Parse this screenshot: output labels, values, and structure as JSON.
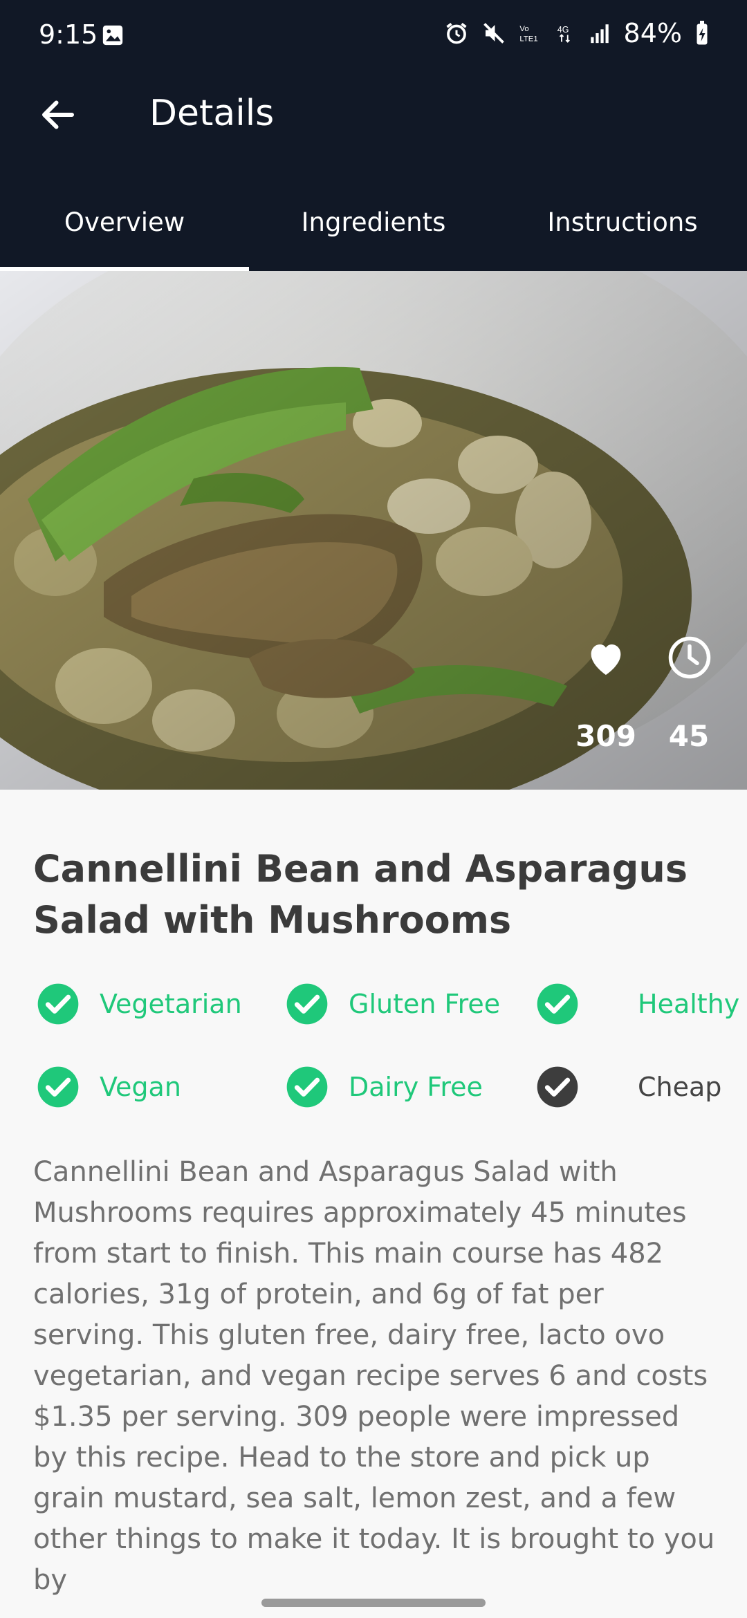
{
  "status_bar": {
    "time": "9:15",
    "battery": "84%"
  },
  "appbar": {
    "title": "Details"
  },
  "tabs": [
    {
      "label": "Overview",
      "active": true
    },
    {
      "label": "Ingredients",
      "active": false
    },
    {
      "label": "Instructions",
      "active": false
    }
  ],
  "hero": {
    "likes": "309",
    "minutes": "45"
  },
  "recipe": {
    "title": "Cannellini Bean and Asparagus Salad with Mushrooms",
    "badges": [
      {
        "label": "Vegetarian",
        "active": true
      },
      {
        "label": "Gluten Free",
        "active": true
      },
      {
        "label": "Healthy",
        "active": true
      },
      {
        "label": "Vegan",
        "active": true
      },
      {
        "label": "Dairy Free",
        "active": true
      },
      {
        "label": "Cheap",
        "active": false
      }
    ],
    "summary": "Cannellini Bean and Asparagus Salad with Mushrooms requires approximately 45 minutes from start to finish. This main course has 482 calories, 31g of protein, and 6g of fat per serving. This gluten free, dairy free, lacto ovo vegetarian, and vegan recipe serves 6 and costs $1.35 per serving. 309 people were impressed by this recipe. Head to the store and pick up grain mustard, sea salt, lemon zest, and a few other things to make it today. It is brought to you by"
  },
  "colors": {
    "header_bg": "#111826",
    "accent_green": "#1fc87a",
    "text_dark": "#3b3b3b",
    "text_gray": "#707070"
  }
}
